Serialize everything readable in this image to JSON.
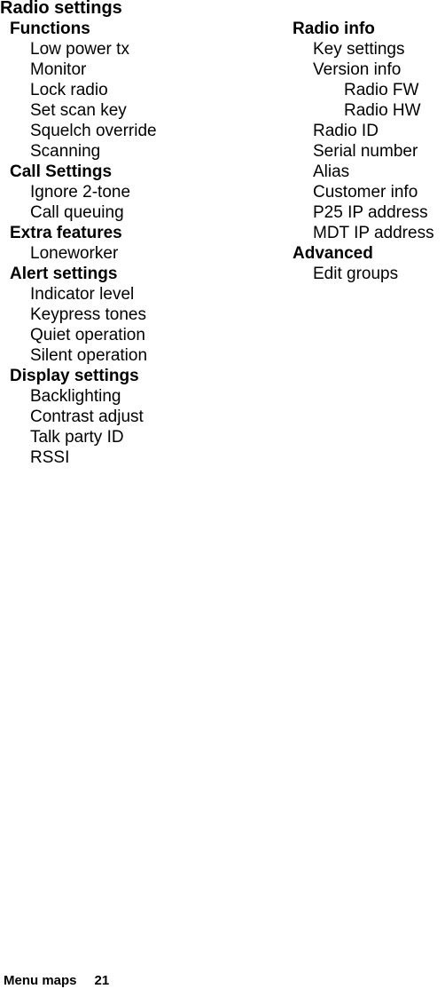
{
  "title": "Radio settings",
  "left_column": [
    {
      "label": "Functions",
      "level": 0
    },
    {
      "label": "Low power tx",
      "level": 1
    },
    {
      "label": "Monitor",
      "level": 1
    },
    {
      "label": "Lock radio",
      "level": 1
    },
    {
      "label": "Set scan key",
      "level": 1
    },
    {
      "label": "Squelch override",
      "level": 1
    },
    {
      "label": "Scanning",
      "level": 1
    },
    {
      "label": "Call Settings",
      "level": 0
    },
    {
      "label": "Ignore 2-tone",
      "level": 1
    },
    {
      "label": "Call queuing",
      "level": 1
    },
    {
      "label": "Extra features",
      "level": 0
    },
    {
      "label": "Loneworker",
      "level": 1
    },
    {
      "label": "Alert settings",
      "level": 0
    },
    {
      "label": "Indicator level",
      "level": 1
    },
    {
      "label": "Keypress tones",
      "level": 1
    },
    {
      "label": "Quiet operation",
      "level": 1
    },
    {
      "label": "Silent operation",
      "level": 1
    },
    {
      "label": "Display settings",
      "level": 0
    },
    {
      "label": "Backlighting",
      "level": 1
    },
    {
      "label": "Contrast adjust",
      "level": 1
    },
    {
      "label": "Talk party ID",
      "level": 1
    },
    {
      "label": "RSSI",
      "level": 1
    }
  ],
  "right_column": [
    {
      "label": "Radio info",
      "level": 0
    },
    {
      "label": "Key settings",
      "level": 1
    },
    {
      "label": "Version info",
      "level": 1
    },
    {
      "label": "Radio FW",
      "level": 2
    },
    {
      "label": "Radio HW",
      "level": 2
    },
    {
      "label": "Radio ID",
      "level": 1
    },
    {
      "label": "Serial number",
      "level": 1
    },
    {
      "label": "Alias",
      "level": 1
    },
    {
      "label": "Customer info",
      "level": 1
    },
    {
      "label": "P25 IP address",
      "level": 1
    },
    {
      "label": "MDT IP address",
      "level": 1
    },
    {
      "label": "Advanced",
      "level": 0
    },
    {
      "label": "Edit groups",
      "level": 1
    }
  ],
  "footer": {
    "section": "Menu maps",
    "page_number": "21"
  }
}
